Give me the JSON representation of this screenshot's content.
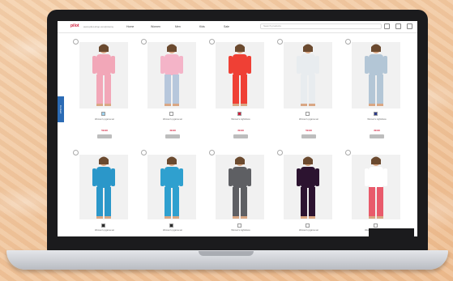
{
  "browser": {
    "logo": "pilot",
    "url": "www.pilot-shop.com/pizamy",
    "nav": [
      "Home",
      "Women",
      "Men",
      "Kids",
      "Sale"
    ],
    "search_placeholder": "Search products",
    "side_tab": "Contact"
  },
  "products": [
    {
      "name": "Women's pyjama set",
      "price": "59.99",
      "top": "#f2a7b8",
      "bottom": "#f2a7b8",
      "swatch": "#9fd4f0"
    },
    {
      "name": "Women's pyjama set",
      "price": "49.99",
      "top": "#f4b4c8",
      "bottom": "#b7c7dc",
      "swatch": "#ffffff"
    },
    {
      "name": "Women's nightdress",
      "price": "39.99",
      "top": "#ef4035",
      "bottom": "#ef4035",
      "swatch": "#d11e3b"
    },
    {
      "name": "Women's pyjama set",
      "price": "59.99",
      "top": "#e8ecef",
      "bottom": "#e8ecef",
      "swatch": "#ffffff"
    },
    {
      "name": "Women's nightdress",
      "price": "39.99",
      "top": "#b3c6d6",
      "bottom": "#b3c6d6",
      "swatch": "#2b3a8a"
    },
    {
      "name": "Women's pyjama set",
      "price": "",
      "top": "#2b97c9",
      "bottom": "#2b97c9",
      "swatch": "#2b2b2b"
    },
    {
      "name": "Women's pyjama set",
      "price": "",
      "top": "#2fa0cf",
      "bottom": "#2fa0cf",
      "swatch": "#2b2b2b"
    },
    {
      "name": "Women's nightdress",
      "price": "",
      "top": "#5e5f63",
      "bottom": "#5e5f63",
      "swatch": "#ffffff"
    },
    {
      "name": "Women's pyjama set",
      "price": "",
      "top": "#2c1330",
      "bottom": "#2c1330",
      "swatch": "#ffffff"
    },
    {
      "name": "Women's pyjama trousers",
      "price": "",
      "top": "#ffffff",
      "bottom": "#e85a6b",
      "swatch": "#ffffff"
    }
  ]
}
